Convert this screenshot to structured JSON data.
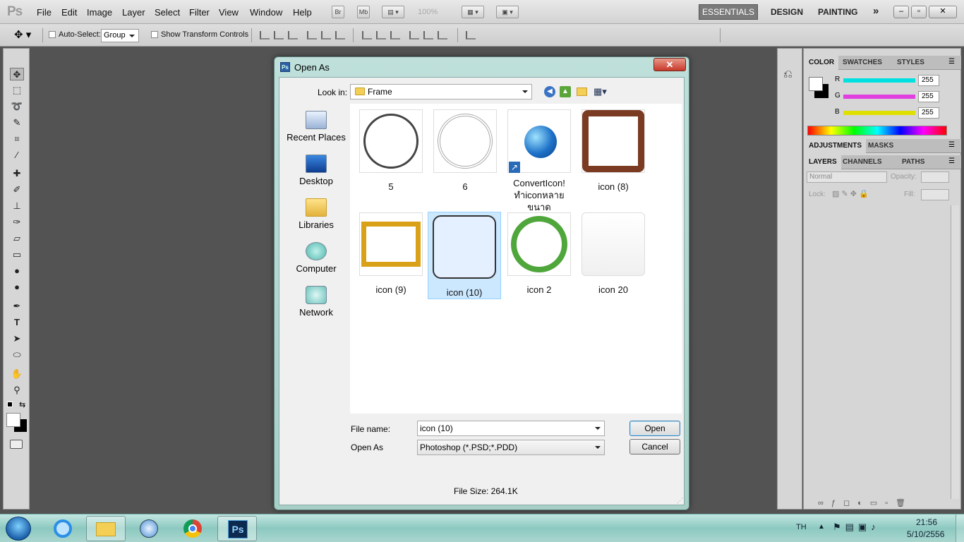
{
  "app": {
    "logo": "Ps",
    "menu": [
      "File",
      "Edit",
      "Image",
      "Layer",
      "Select",
      "Filter",
      "View",
      "Window",
      "Help"
    ],
    "bridge_buttons": [
      "Br",
      "Mb"
    ],
    "zoom": "100%",
    "workspaces": [
      "ESSENTIALS",
      "DESIGN",
      "PAINTING"
    ],
    "more_workspaces": "»"
  },
  "options_bar": {
    "auto_select_label": "Auto-Select:",
    "auto_select_value": "Group",
    "show_transform_label": "Show Transform Controls"
  },
  "panels": {
    "color_tabs": [
      "COLOR",
      "SWATCHES",
      "STYLES"
    ],
    "sliders": [
      {
        "label": "R",
        "value": "255",
        "color": "#00e0e0"
      },
      {
        "label": "G",
        "value": "255",
        "color": "#e040e0"
      },
      {
        "label": "B",
        "value": "255",
        "color": "#e0e000"
      }
    ],
    "adjust_tabs": [
      "ADJUSTMENTS",
      "MASKS"
    ],
    "layer_tabs": [
      "LAYERS",
      "CHANNELS",
      "PATHS"
    ],
    "blend_mode": "Normal",
    "opacity_label": "Opacity:",
    "lock_label": "Lock:",
    "fill_label": "Fill:"
  },
  "dialog": {
    "title": "Open As",
    "look_in_label": "Look in:",
    "look_in_value": "Frame",
    "places": [
      "Recent Places",
      "Desktop",
      "Libraries",
      "Computer",
      "Network"
    ],
    "files": [
      {
        "name": "5"
      },
      {
        "name": "6"
      },
      {
        "name": "ConvertIcon!\nทำiconหลายขนาด"
      },
      {
        "name": "icon (8)"
      },
      {
        "name": "icon (9)"
      },
      {
        "name": "icon (10)",
        "selected": true
      },
      {
        "name": "icon 2"
      },
      {
        "name": "icon 20"
      }
    ],
    "file_name_label": "File name:",
    "file_name_value": "icon (10)",
    "open_as_label": "Open As",
    "open_as_value": "Photoshop (*.PSD;*.PDD)",
    "open_button": "Open",
    "cancel_button": "Cancel",
    "file_size": "File Size: 264.1K"
  },
  "taskbar": {
    "lang": "TH",
    "time": "21:56",
    "date": "5/10/2556",
    "ps_label": "Ps"
  }
}
